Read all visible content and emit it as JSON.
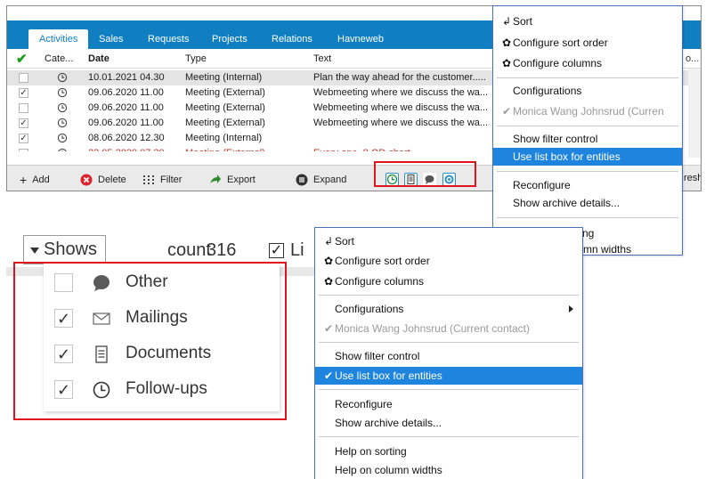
{
  "colors": {
    "accent": "#0f7fc1",
    "highlight": "#1f84dd",
    "red_box": "#e0141e",
    "menu_border": "#4b71b8"
  },
  "tabs": [
    "Activities",
    "Sales",
    "Requests",
    "Projects",
    "Relations",
    "Havneweb"
  ],
  "tab_right_fragment": "o...",
  "grid": {
    "columns": [
      "Cate...",
      "Date",
      "Type",
      "Text"
    ],
    "rows": [
      {
        "checked": false,
        "icon": "clock-icon",
        "date": "10.01.2021 04.30",
        "type": "Meeting (Internal)",
        "text": "Plan the way ahead for the customer....."
      },
      {
        "checked": true,
        "icon": "clock-icon",
        "date": "09.06.2020 11.00",
        "type": "Meeting (External)",
        "text": "Webmeeting where we discuss the wa..."
      },
      {
        "checked": false,
        "icon": "clock-icon",
        "date": "09.06.2020 11.00",
        "type": "Meeting (External)",
        "text": "Webmeeting where we discuss the wa..."
      },
      {
        "checked": true,
        "icon": "clock-icon",
        "date": "09.06.2020 11.00",
        "type": "Meeting (External)",
        "text": "Webmeeting where we discuss the wa..."
      },
      {
        "checked": true,
        "icon": "clock-icon",
        "date": "08.06.2020 12.30",
        "type": "Meeting (Internal)",
        "text": ""
      },
      {
        "checked": false,
        "icon": "clock-icon",
        "date": "22.05.2020 07.30",
        "type": "Meeting (External)",
        "text": "Every one, 8 OD chart"
      }
    ]
  },
  "toolbar": {
    "add": "Add",
    "delete": "Delete",
    "filter": "Filter",
    "export": "Export",
    "expand": "Expand",
    "refresh_fragment": "resh",
    "mini_icons": [
      "clock-icon",
      "document-icon",
      "chat-icon",
      "target-icon"
    ]
  },
  "menu_top": {
    "items": [
      {
        "label": "Sort",
        "prefix": "sort-icon"
      },
      {
        "label": "Configure sort order",
        "prefix": "gear-icon"
      },
      {
        "label": "Configure columns",
        "prefix": "gear-icon"
      },
      {
        "label": "Configurations"
      },
      {
        "label": "Monica Wang Johnsrud (Curren",
        "prefix": "check-icon",
        "disabled": true
      },
      {
        "label": "Show filter control"
      },
      {
        "label": "Use list box for entities",
        "highlight": true
      },
      {
        "label": "Reconfigure"
      },
      {
        "label": "Show archive details..."
      },
      {
        "label": "ng"
      },
      {
        "label": "mn widths"
      }
    ]
  },
  "shows": {
    "label": "Shows",
    "count_label": "count",
    "count_value": "316",
    "live_fragment": "Li",
    "items": [
      {
        "label": "Other",
        "checked": false,
        "icon": "chat-bubble-icon"
      },
      {
        "label": "Mailings",
        "checked": true,
        "icon": "envelope-icon"
      },
      {
        "label": "Documents",
        "checked": true,
        "icon": "document-icon"
      },
      {
        "label": "Follow-ups",
        "checked": true,
        "icon": "clock-icon"
      }
    ]
  },
  "menu_bottom": {
    "items": [
      {
        "label": "Sort",
        "prefix": "sort-icon"
      },
      {
        "label": "Configure sort order",
        "prefix": "gear-icon"
      },
      {
        "label": "Configure columns",
        "prefix": "gear-icon"
      },
      {
        "label": "Configurations",
        "submenu": true
      },
      {
        "label": "Monica Wang Johnsrud (Current contact)",
        "prefix": "check-icon",
        "disabled": true
      },
      {
        "label": "Show filter control"
      },
      {
        "label": "Use list box for entities",
        "prefix": "check-icon",
        "highlight": true
      },
      {
        "label": "Reconfigure"
      },
      {
        "label": "Show archive details..."
      },
      {
        "label": "Help on sorting"
      },
      {
        "label": "Help on column widths"
      }
    ]
  }
}
